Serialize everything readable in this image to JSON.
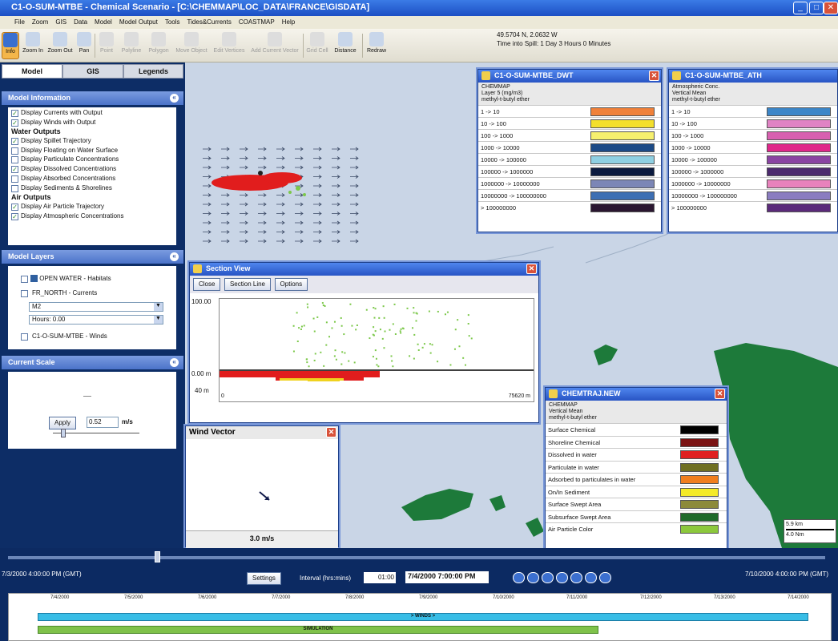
{
  "window": {
    "title": "C1-O-SUM-MTBE - Chemical Scenario - [C:\\CHEMMAP\\LOC_DATA\\FRANCE\\GISDATA]",
    "min_label": "_",
    "max_label": "□",
    "close_label": "✕"
  },
  "menu": {
    "items": [
      "File",
      "Zoom",
      "GIS",
      "Data",
      "Model",
      "Model Output",
      "Tools",
      "Tides&Currents",
      "COASTMAP",
      "Help"
    ]
  },
  "toolbar": {
    "tools": [
      {
        "label": "Info",
        "enabled": true
      },
      {
        "label": "Zoom In",
        "enabled": true
      },
      {
        "label": "Zoom Out",
        "enabled": true
      },
      {
        "label": "Pan",
        "enabled": true
      },
      {
        "label": "Point",
        "enabled": false
      },
      {
        "label": "Polyline",
        "enabled": false
      },
      {
        "label": "Polygon",
        "enabled": false
      },
      {
        "label": "Move Object",
        "enabled": false
      },
      {
        "label": "Edit Vertices",
        "enabled": false
      },
      {
        "label": "Add Current Vector",
        "enabled": false
      },
      {
        "label": "Grid Cell",
        "enabled": false
      },
      {
        "label": "Distance",
        "enabled": true
      },
      {
        "label": "Redraw",
        "enabled": true
      }
    ],
    "coordinates": "49.5704 N, 2.0632 W",
    "time_into_spill": "Time into Spill: 1 Day 3 Hours 0 Minutes"
  },
  "left_panel": {
    "tabs": [
      "Model",
      "GIS",
      "Legends"
    ],
    "model_information": {
      "title": "Model Information",
      "rows": [
        {
          "kind": "check",
          "label": "Display Currents with Output",
          "checked": true
        },
        {
          "kind": "check",
          "label": "Display Winds with Output",
          "checked": true
        },
        {
          "kind": "group",
          "label": "Water Outputs"
        },
        {
          "kind": "check",
          "label": "Display Spillet Trajectory",
          "checked": true
        },
        {
          "kind": "check",
          "label": "Display Floating on Water Surface",
          "checked": false
        },
        {
          "kind": "check",
          "label": "Display Particulate Concentrations",
          "checked": false
        },
        {
          "kind": "check",
          "label": "Display Dissolved Concentrations",
          "checked": true
        },
        {
          "kind": "check",
          "label": "Display Absorbed Concentrations",
          "checked": false
        },
        {
          "kind": "check",
          "label": "Display Sediments & Shorelines",
          "checked": false
        },
        {
          "kind": "group",
          "label": "Air Outputs"
        },
        {
          "kind": "check",
          "label": "Display Air Particle Trajectory",
          "checked": true
        },
        {
          "kind": "check",
          "label": "Display Atmospheric Concentrations",
          "checked": true
        }
      ]
    },
    "model_layers": {
      "title": "Model Layers",
      "layer1": "OPEN WATER - Habitats",
      "layer2": "FR_NORTH - Currents",
      "select1": "M2",
      "select2": "Hours: 0.00",
      "layer3": "C1-O-SUM-MTBE - Winds"
    },
    "current_scale": {
      "title": "Current Scale",
      "apply_label": "Apply",
      "value": "0.52",
      "unit": "m/s",
      "slider_level": 0.1
    }
  },
  "legend_dwt": {
    "title": "C1-O-SUM-MTBE_DWT",
    "meta": [
      "CHEMMAP",
      "Layer 5 (mg/m3)",
      "methyl-t-butyl ether"
    ],
    "rows": [
      {
        "label": "1 -> 10",
        "color": "#f0813a"
      },
      {
        "label": "10 -> 100",
        "color": "#f3df2c"
      },
      {
        "label": "100 -> 1000",
        "color": "#f6f06e"
      },
      {
        "label": "1000 -> 10000",
        "color": "#1c4a86"
      },
      {
        "label": "10000 -> 100000",
        "color": "#8fd0e2"
      },
      {
        "label": "100000 -> 1000000",
        "color": "#0b1a3e"
      },
      {
        "label": "1000000 -> 10000000",
        "color": "#7c86b6"
      },
      {
        "label": "10000000 -> 100000000",
        "color": "#3d6fb3"
      },
      {
        "label": "> 100000000",
        "color": "#2a1630"
      }
    ]
  },
  "legend_ath": {
    "title": "C1-O-SUM-MTBE_ATH",
    "meta": [
      "Atmospheric Conc.",
      "Vertical Mean",
      "methyl-t-butyl ether"
    ],
    "rows": [
      {
        "label": "1 -> 10",
        "color": "#3c86c8"
      },
      {
        "label": "10 -> 100",
        "color": "#e083c4"
      },
      {
        "label": "100 -> 1000",
        "color": "#d860b0"
      },
      {
        "label": "1000 -> 10000",
        "color": "#e0268a"
      },
      {
        "label": "10000 -> 100000",
        "color": "#8a44a2"
      },
      {
        "label": "100000 -> 1000000",
        "color": "#4c2a6e"
      },
      {
        "label": "1000000 -> 10000000",
        "color": "#e882bc"
      },
      {
        "label": "10000000 -> 100000000",
        "color": "#8a7cc0"
      },
      {
        "label": "> 100000000",
        "color": "#5b2a7a"
      }
    ]
  },
  "legend_traj": {
    "title": "CHEMTRAJ.NEW",
    "meta": [
      "CHEMMAP",
      "Vertical Mean",
      "methyl-t-butyl ether"
    ],
    "rows": [
      {
        "label": "Surface Chemical",
        "color": "#000000"
      },
      {
        "label": "Shoreline Chemical",
        "color": "#7a1212"
      },
      {
        "label": "Dissolved in water",
        "color": "#e02020"
      },
      {
        "label": "Particulate in water",
        "color": "#6f6f22"
      },
      {
        "label": "Adsorbed to particulates in water",
        "color": "#f07e1e"
      },
      {
        "label": "On/In Sediment",
        "color": "#f4ea28"
      },
      {
        "label": "Surface Swept Area",
        "color": "#8c8a3a"
      },
      {
        "label": "Subsurface Swept Area",
        "color": "#1f6a2a"
      },
      {
        "label": "Air Particle Color",
        "color": "#8cc83c"
      }
    ]
  },
  "section_view": {
    "title": "Section View",
    "buttons": [
      "Close",
      "Section Line",
      "Options"
    ],
    "y_top": "100.00",
    "y_mid": "0.00 m",
    "y_bottom": "40 m",
    "x_left": "0",
    "x_right": "75620 m"
  },
  "wind_vector": {
    "title": "Wind Vector",
    "speed": "3.0 m/s"
  },
  "scale_bar": {
    "km": "5.9 km",
    "nm": "4.0 Nm"
  },
  "timeline": {
    "start": "7/3/2000 4:00:00 PM (GMT)",
    "settings_label": "Settings",
    "interval_label": "Interval (hrs:mins)",
    "interval_value": "01:00",
    "current": "7/4/2000 7:00:00 PM",
    "end": "7/10/2000 4:00:00 PM (GMT)",
    "slider_fraction": 0.18,
    "dates": [
      "7/4/2000",
      "7/5/2000",
      "7/6/2000",
      "7/7/2000",
      "7/8/2000",
      "7/9/2000",
      "7/10/2000",
      "7/11/2000",
      "7/12/2000",
      "7/13/2000",
      "7/14/2000"
    ],
    "winds_bar": "> WINDS >",
    "simulation_bar": "SIMULATION"
  }
}
